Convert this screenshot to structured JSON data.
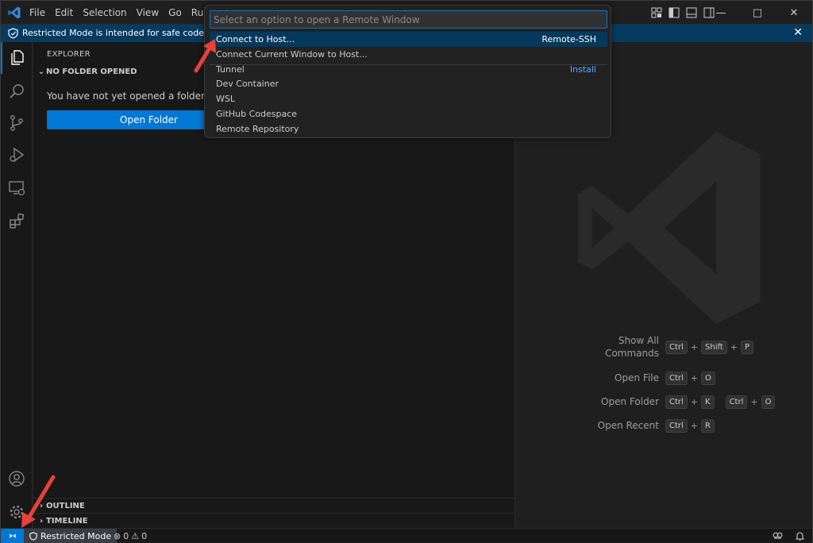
{
  "menu": [
    "File",
    "Edit",
    "Selection",
    "View",
    "Go",
    "Run"
  ],
  "banner": {
    "text": "Restricted Mode is intended for safe code browsing"
  },
  "explorer": {
    "title": "EXPLORER",
    "section": "NO FOLDER OPENED",
    "message": "You have not yet opened a folder.",
    "open_folder_label": "Open Folder",
    "outline": "OUTLINE",
    "timeline": "TIMELINE"
  },
  "quickpick": {
    "placeholder": "Select an option to open a Remote Window",
    "items": [
      {
        "label": "Connect to Host...",
        "detail": "Remote-SSH"
      },
      {
        "label": "Connect Current Window to Host...",
        "detail": ""
      },
      {
        "label": "Tunnel",
        "detail": "Install"
      },
      {
        "label": "Dev Container",
        "detail": ""
      },
      {
        "label": "WSL",
        "detail": ""
      },
      {
        "label": "GitHub Codespace",
        "detail": ""
      },
      {
        "label": "Remote Repository",
        "detail": ""
      }
    ]
  },
  "shortcuts": [
    {
      "label_line1": "Show All",
      "label_line2": "Commands",
      "keys": [
        "Ctrl",
        "Shift",
        "P"
      ]
    },
    {
      "label": "Open File",
      "keys": [
        "Ctrl",
        "O"
      ]
    },
    {
      "label": "Open Folder",
      "keys": [
        "Ctrl",
        "K"
      ],
      "keys2": [
        "Ctrl",
        "O"
      ]
    },
    {
      "label": "Open Recent",
      "keys": [
        "Ctrl",
        "R"
      ]
    }
  ],
  "status": {
    "restricted": "Restricted Mode",
    "errors": "0",
    "warnings": "0"
  },
  "colors": {
    "accent": "#0078d4",
    "arrow": "#e8403a"
  }
}
